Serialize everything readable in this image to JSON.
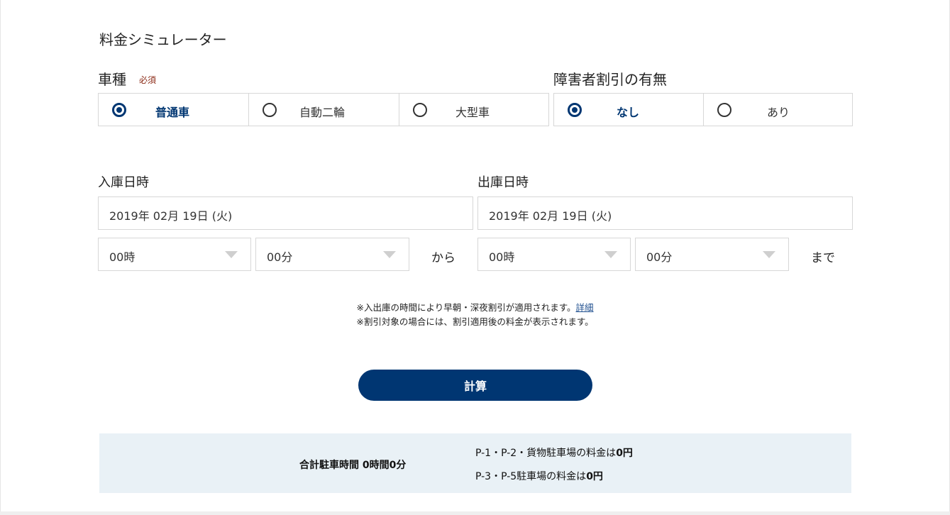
{
  "title": "料金シミュレーター",
  "vehicle": {
    "label": "車種",
    "required": "必須",
    "options": [
      {
        "label": "普通車",
        "selected": true
      },
      {
        "label": "自動二輪",
        "selected": false
      },
      {
        "label": "大型車",
        "selected": false
      }
    ]
  },
  "discount": {
    "label": "障害者割引の有無",
    "options": [
      {
        "label": "なし",
        "selected": true
      },
      {
        "label": "あり",
        "selected": false
      }
    ]
  },
  "entry": {
    "label": "入庫日時",
    "date": "2019年 02月 19日 (火)",
    "hour": "00時",
    "minute": "00分",
    "suffix": "から"
  },
  "exit": {
    "label": "出庫日時",
    "date": "2019年 02月 19日 (火)",
    "hour": "00時",
    "minute": "00分",
    "suffix": "まで"
  },
  "notes": {
    "line1": "※入出庫の時間により早朝・深夜割引が適用されます。",
    "line1_link": "詳細",
    "line2": "※割引対象の場合には、割引適用後の料金が表示されます。"
  },
  "calc_button": "計算",
  "result": {
    "total_label": "合計駐車時間 0時間0分",
    "fee1_prefix": "P-1・P-2・貨物駐車場の料金は",
    "fee1_value": "0円",
    "fee2_prefix": "P-3・P-5駐車場の料金は",
    "fee2_value": "0円"
  },
  "colors": {
    "accent": "#003672",
    "result_bg": "#e9f1f6",
    "required": "#8b2a16"
  }
}
